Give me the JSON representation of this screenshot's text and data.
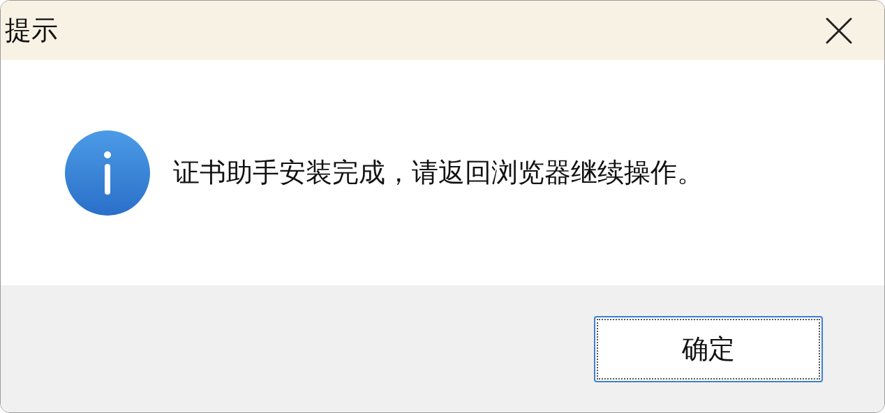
{
  "window": {
    "title": "提示"
  },
  "message": "证书助手安装完成，请返回浏览器继续操作。",
  "buttons": [
    {
      "label": "确定",
      "focused": true
    }
  ]
}
